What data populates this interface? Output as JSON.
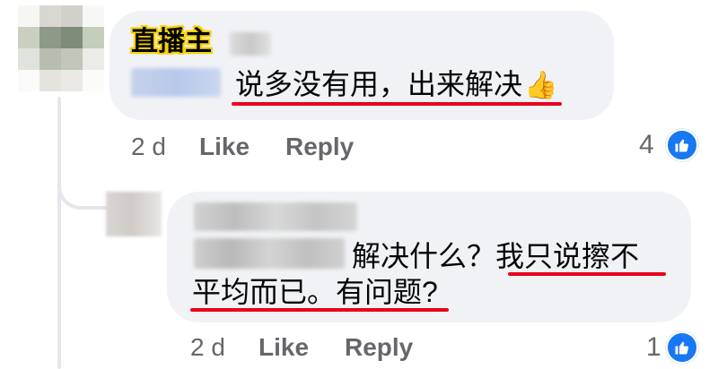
{
  "comment1": {
    "badge": "直播主",
    "text": "说多没有用，出来解决",
    "emoji": "👍",
    "time": "2 d",
    "like_label": "Like",
    "reply_label": "Reply",
    "reaction_count": "4"
  },
  "comment2": {
    "text_line1_prefix": "解决什么？",
    "text_line1_highlight": "我只说擦不",
    "text_line2": "平均而已。有问题?",
    "time": "2 d",
    "like_label": "Like",
    "reply_label": "Reply",
    "reaction_count": "1"
  },
  "colors": {
    "bubble": "#f0f2f5",
    "meta_text": "#65676b",
    "like_blue": "#1877f2",
    "highlight_red": "#e8001c",
    "badge_yellow": "#f5d200"
  },
  "icons": {
    "reaction": "thumbs-up-icon"
  }
}
